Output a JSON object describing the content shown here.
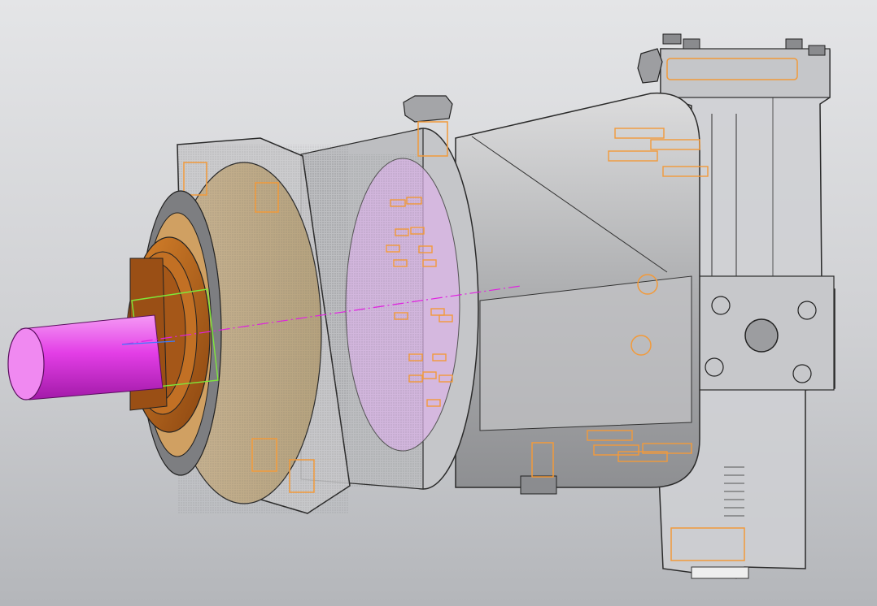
{
  "viewport": {
    "background_top": "#e4e5e7",
    "background_bottom": "#b4b6ba"
  },
  "model": {
    "body_color": "#b9babc",
    "housing_color": "#d6d7d9",
    "flange_color": "#c8b89a",
    "copper_color": "#b8651a",
    "shaft_color": "#e33ee6",
    "bolt_outline_color": "#f29a3a",
    "transparent_cover_color": "#d9b3e6",
    "axis_color": "#e020e0",
    "selection_box_color": "#7ee83a"
  }
}
